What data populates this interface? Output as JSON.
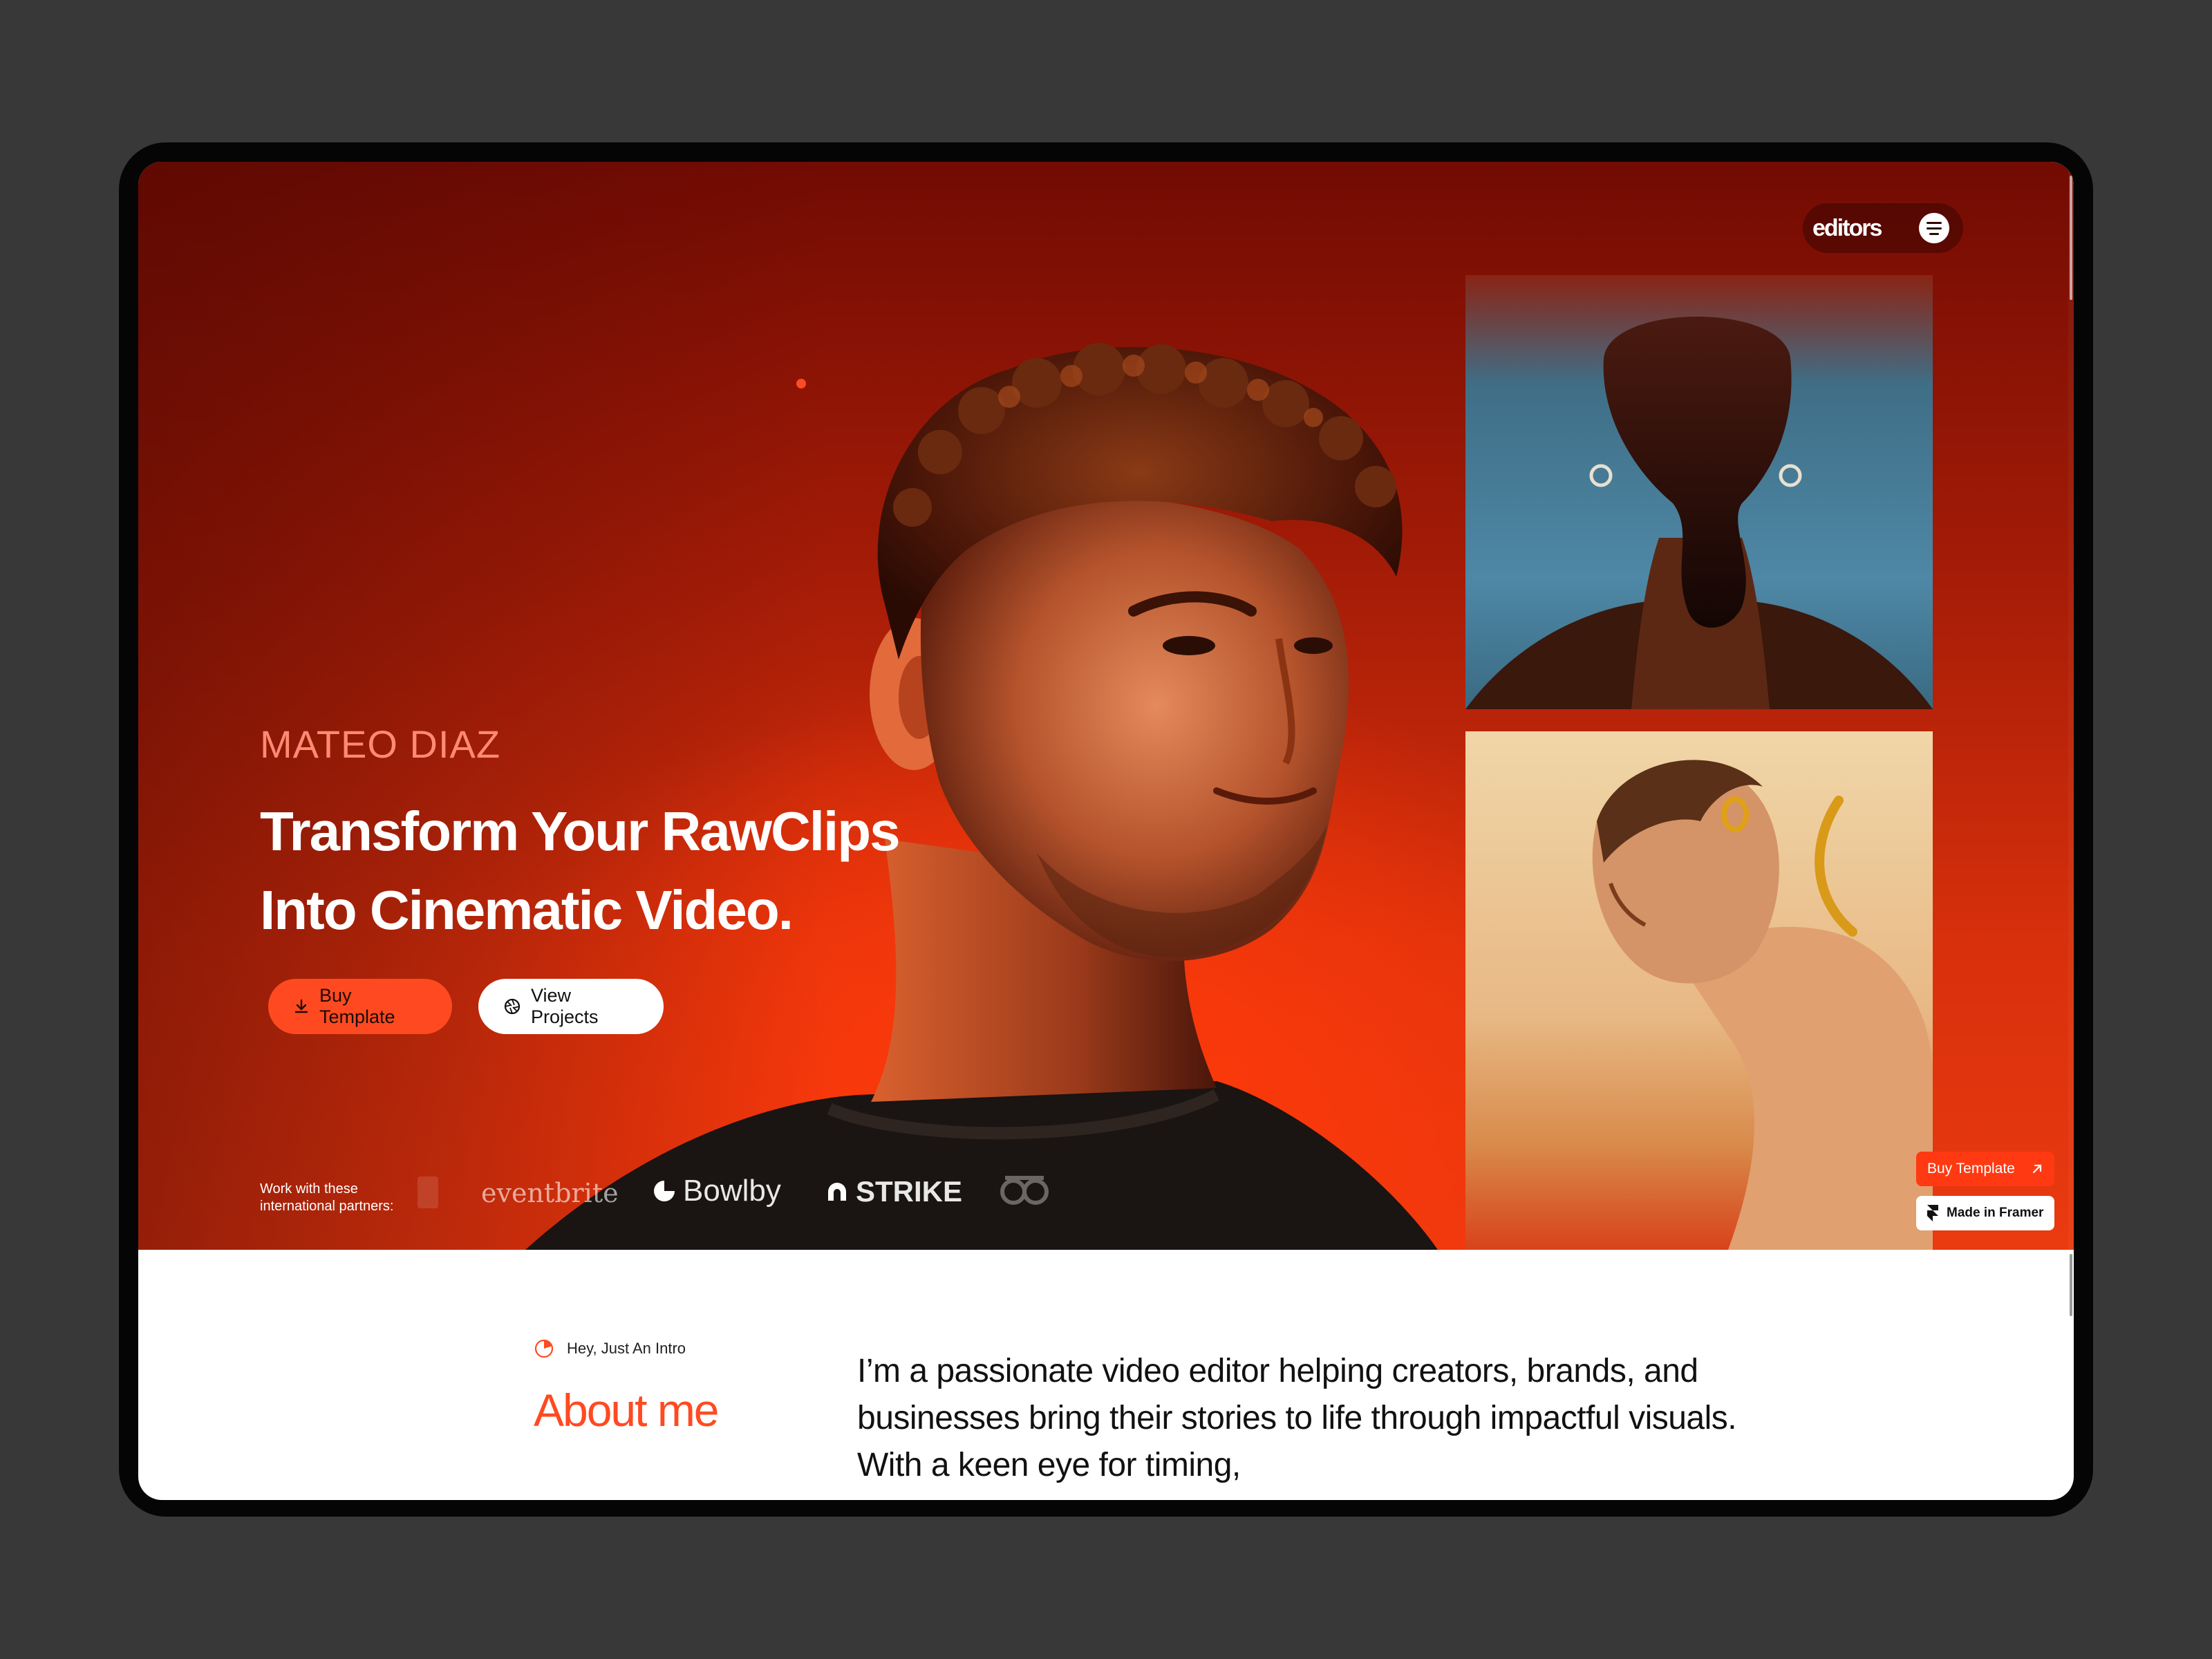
{
  "nav": {
    "logo": "editors",
    "menu_icon": "menu-icon"
  },
  "hero": {
    "name": "MATEO DIAZ",
    "headline_line1": "Transform Your RawClips",
    "headline_line2": "Into Cinematic Video.",
    "buy_button": "Buy Template",
    "buy_icon": "download-icon",
    "view_button": "View Projects",
    "view_icon": "aperture-icon"
  },
  "partners": {
    "label_line1": "Work with these",
    "label_line2": "international partners:",
    "items": [
      "eventbrite",
      "Bowlby",
      "STRIKE"
    ]
  },
  "framer": {
    "buy_label": "Buy Template",
    "buy_icon": "arrow-up-right-icon",
    "made_label": "Made in Framer",
    "made_icon": "framer-icon"
  },
  "about": {
    "eyebrow": "Hey, Just An Intro",
    "title": "About me",
    "body": "I’m a passionate video editor helping creators, brands, and businesses bring their stories to life through impactful visuals. With a keen eye for timing,"
  },
  "colors": {
    "accent": "#ff4a21",
    "hero_deep": "#720b03",
    "hero_bright": "#ea3a10",
    "page_bg": "#383838"
  }
}
